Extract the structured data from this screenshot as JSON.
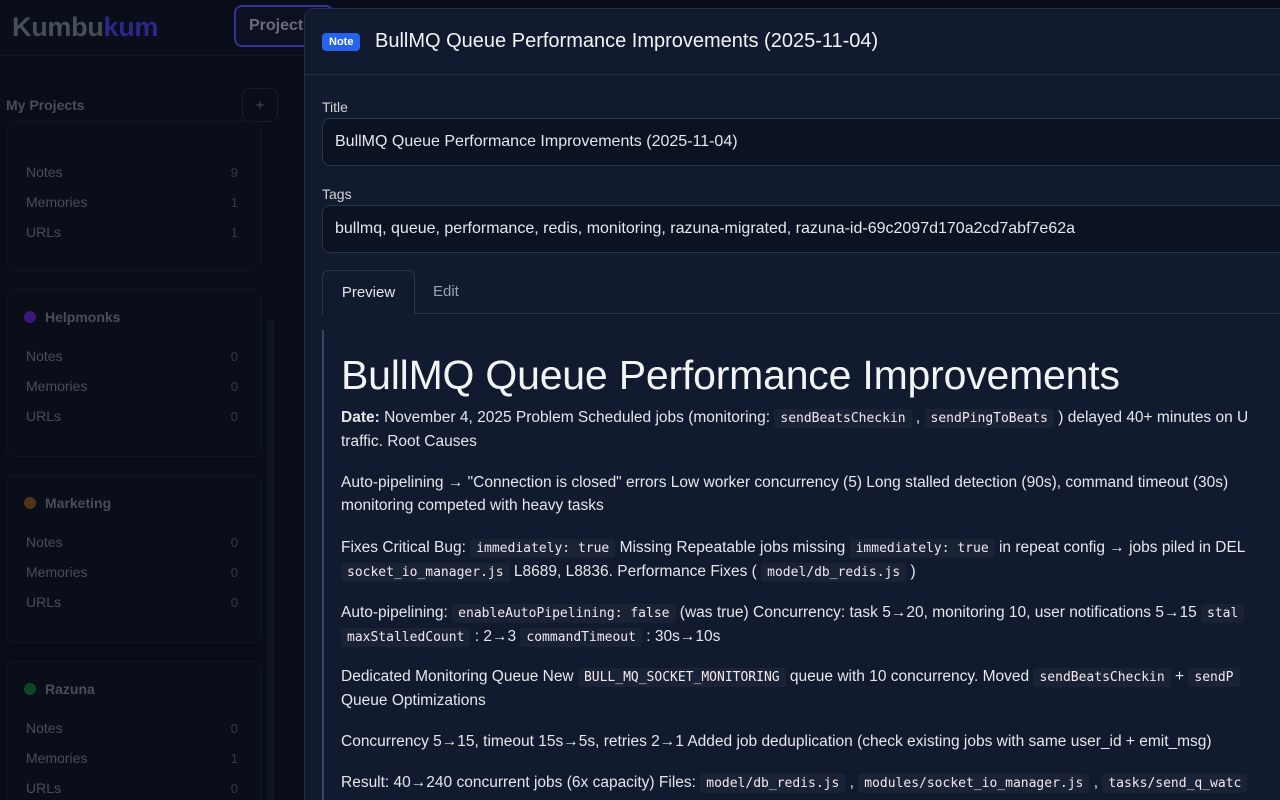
{
  "app": {
    "logo_part1": "Kumbu",
    "logo_part2": "kum",
    "projects_button": "Projects"
  },
  "sidebar": {
    "title": "My Projects",
    "add_icon": "plus-icon",
    "projects": [
      {
        "name": "",
        "rows": [
          {
            "label": "Notes",
            "count": "9"
          },
          {
            "label": "Memories",
            "count": "1"
          },
          {
            "label": "URLs",
            "count": "1"
          }
        ]
      },
      {
        "name": "Helpmonks",
        "color": "#5b21b6",
        "rows": [
          {
            "label": "Notes",
            "count": "0"
          },
          {
            "label": "Memories",
            "count": "0"
          },
          {
            "label": "URLs",
            "count": "0"
          }
        ]
      },
      {
        "name": "Marketing",
        "color": "#7c4a1e",
        "rows": [
          {
            "label": "Notes",
            "count": "0"
          },
          {
            "label": "Memories",
            "count": "0"
          },
          {
            "label": "URLs",
            "count": "0"
          }
        ]
      },
      {
        "name": "Razuna",
        "color": "#166534",
        "rows": [
          {
            "label": "Notes",
            "count": "0"
          },
          {
            "label": "Memories",
            "count": "1"
          },
          {
            "label": "URLs",
            "count": "0"
          }
        ]
      }
    ]
  },
  "modal": {
    "badge": "Note",
    "title": "BullMQ Queue Performance Improvements (2025-11-04)",
    "title_label": "Title",
    "title_value": "BullMQ Queue Performance Improvements (2025-11-04)",
    "tags_label": "Tags",
    "tags_value": "bullmq, queue, performance, redis, monitoring, razuna-migrated, razuna-id-69c2097d170a2cd7abf7e62a",
    "tabs": [
      {
        "label": "Preview",
        "active": true
      },
      {
        "label": "Edit",
        "active": false
      }
    ],
    "preview": {
      "heading": "BullMQ Queue Performance Improvements",
      "p1": {
        "date_label": "Date:",
        "t1": " November 4, 2025 Problem Scheduled jobs (monitoring: ",
        "c1": "sendBeatsCheckin",
        "t2": " , ",
        "c2": "sendPingToBeats",
        "t3": " ) delayed 40+ minutes on U",
        "line2": "traffic. Root Causes"
      },
      "p2": {
        "line1": "Auto-pipelining → \"Connection is closed\" errors Low worker concurrency (5) Long stalled detection (90s), command timeout (30s)",
        "line2": "monitoring competed with heavy tasks"
      },
      "p3": {
        "t1": "Fixes Critical Bug: ",
        "c1": "immediately: true",
        "t2": " Missing Repeatable jobs missing ",
        "c2": "immediately: true",
        "t3": " in repeat config → jobs piled in DEL",
        "c3": "socket_io_manager.js",
        "t4": " L8689, L8836. Performance Fixes ( ",
        "c4": "model/db_redis.js",
        "t5": " )"
      },
      "p4": {
        "t1": "Auto-pipelining: ",
        "c1": "enableAutoPipelining: false",
        "t2": " (was true) Concurrency: task 5→20, monitoring 10, user notifications 5→15 ",
        "c2": "stal",
        "c3": "maxStalledCount",
        "t3": " : 2→3 ",
        "c4": "commandTimeout",
        "t4": " : 30s→10s"
      },
      "p5": {
        "t1": "Dedicated Monitoring Queue New ",
        "c1": "BULL_MQ_SOCKET_MONITORING",
        "t2": " queue with 10 concurrency. Moved ",
        "c2": "sendBeatsCheckin",
        "t3": " + ",
        "c3": "sendP",
        "line2": "Queue Optimizations"
      },
      "p6": "Concurrency 5→15, timeout 15s→5s, retries 2→1 Added job deduplication (check existing jobs with same user_id + emit_msg)",
      "p7": {
        "t1": "Result: 40→240 concurrent jobs (6x capacity) Files: ",
        "c1": "model/db_redis.js",
        "t2": " , ",
        "c2": "modules/socket_io_manager.js",
        "t3": " , ",
        "c3": "tasks/send_q_watc"
      }
    }
  }
}
